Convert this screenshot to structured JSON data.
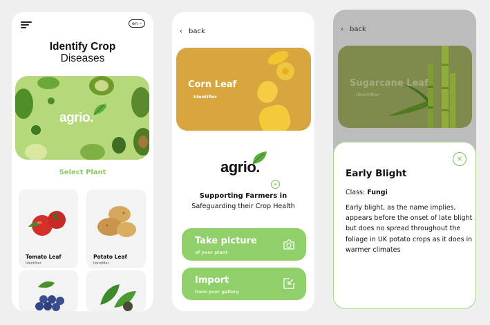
{
  "screen1": {
    "lang": "en",
    "title_line1": "Identify Crop",
    "title_line2": "Diseases",
    "hero_logo": "agrio.",
    "select_plant": "Select Plant",
    "plants": [
      {
        "name": "Tomato Leaf",
        "sub": "Identifier"
      },
      {
        "name": "Potato Leaf",
        "sub": "Identifier"
      },
      {
        "name": "",
        "sub": ""
      },
      {
        "name": "",
        "sub": ""
      }
    ],
    "accent": "#8cc85c"
  },
  "screen2": {
    "back": "back",
    "card_title": "Corn Leaf",
    "card_sub": "Identifier",
    "logo": "agrio.",
    "support_bold": "Supporting Farmers in",
    "support_text": "Safeguarding their Crop Health",
    "take_label": "Take picture",
    "take_sub": "of your plant",
    "import_label": "Import",
    "import_sub": "from your gallery",
    "button_color": "#8fd06a"
  },
  "screen3": {
    "back": "back",
    "card_title": "Sugarcane Leaf",
    "card_sub": "Identifier",
    "sheet_title": "Early Blight",
    "class_label": "Class:",
    "class_value": "Fungi",
    "description": "Early blight, as the name implies, appears before the onset of late blight but does no spread throughout the foliage in UK potato crops as it does in warmer climates"
  }
}
